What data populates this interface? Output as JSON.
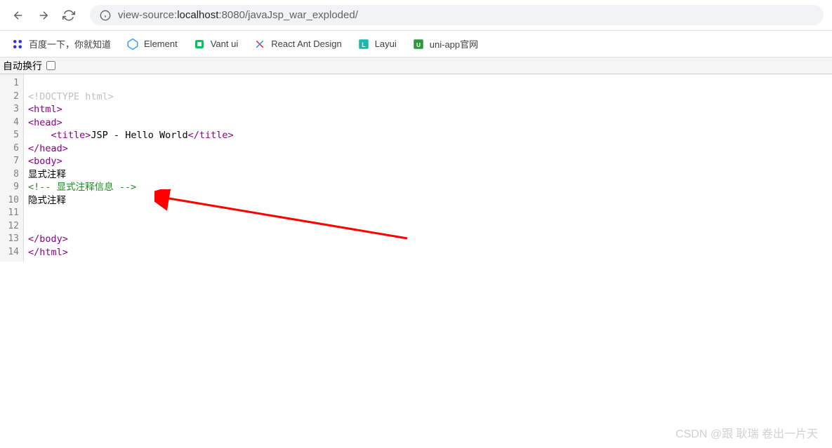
{
  "toolbar": {
    "url_prefix": "view-source:",
    "url_host": "localhost",
    "url_port_path": ":8080/javaJsp_war_exploded/"
  },
  "bookmarks": [
    {
      "label": "百度一下，你就知道",
      "icon_color": "#2932e1"
    },
    {
      "label": "Element",
      "icon_color": "#409eff"
    },
    {
      "label": "Vant ui",
      "icon_color": "#07c160"
    },
    {
      "label": "React Ant Design",
      "icon_color": "#f5222d"
    },
    {
      "label": "Layui",
      "icon_color": "#16baaa"
    },
    {
      "label": "uni-app官网",
      "icon_color": "#2b9939"
    }
  ],
  "autowrap": {
    "label": "自动换行"
  },
  "source": {
    "lines": [
      {
        "n": 1,
        "content": ""
      },
      {
        "n": 2,
        "content": "<!DOCTYPE html>"
      },
      {
        "n": 3,
        "content": "<html>"
      },
      {
        "n": 4,
        "content": "<head>"
      },
      {
        "n": 5,
        "content": "    <title>JSP - Hello World</title>"
      },
      {
        "n": 6,
        "content": "</head>"
      },
      {
        "n": 7,
        "content": "<body>"
      },
      {
        "n": 8,
        "content": "显式注释"
      },
      {
        "n": 9,
        "content": "<!-- 显式注释信息 -->"
      },
      {
        "n": 10,
        "content": "隐式注释"
      },
      {
        "n": 11,
        "content": ""
      },
      {
        "n": 12,
        "content": ""
      },
      {
        "n": 13,
        "content": "</body>"
      },
      {
        "n": 14,
        "content": "</html>"
      }
    ]
  },
  "watermark": "CSDN @跟 耿瑞 卷出一片天"
}
